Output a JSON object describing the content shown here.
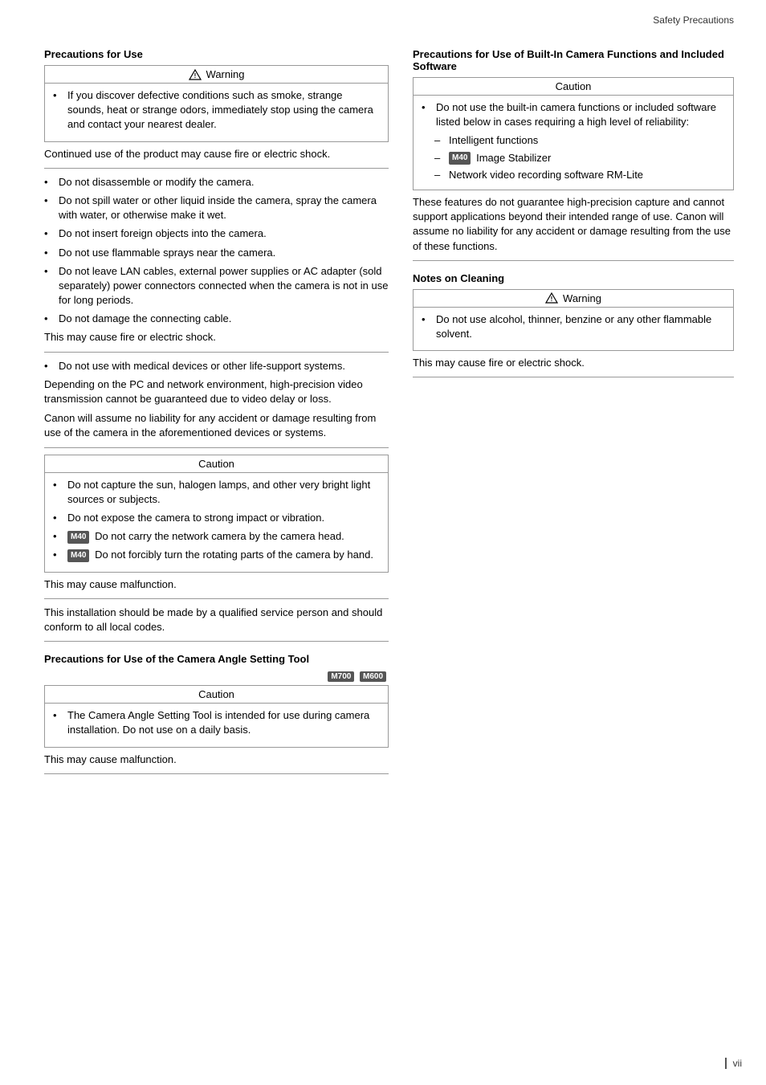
{
  "header": {
    "title": "Safety Precautions"
  },
  "page_number": "vii",
  "left": {
    "precautions_for_use": {
      "title": "Precautions for Use",
      "warning_box": {
        "label": "Warning",
        "items": [
          "If you discover defective conditions such as smoke, strange sounds, heat or strange odors, immediately stop using the camera and contact your nearest dealer."
        ]
      },
      "note1": "Continued use of the product may cause fire or electric shock.",
      "bullets": [
        "Do not disassemble or modify the camera.",
        "Do not spill water or other liquid inside the camera, spray the camera with water, or otherwise make it wet.",
        "Do not insert foreign objects into the camera.",
        "Do not use flammable sprays near the camera.",
        "Do not leave LAN cables, external power supplies or AC adapter (sold separately) power connectors connected when the camera is not in use for long periods.",
        "Do not damage the connecting cable."
      ],
      "note2": "This may cause fire or electric shock.",
      "bullets2": [
        "Do not use with medical devices or other life-support systems."
      ],
      "note3": "Depending on the PC and network environment, high-precision video transmission cannot be guaranteed due to video delay or loss.",
      "note4": "Canon will assume no liability for any accident or damage resulting from use of the camera in the aforementioned devices or systems.",
      "caution_box": {
        "label": "Caution",
        "items": [
          "Do not capture the sun, halogen lamps, and other very bright light sources or subjects.",
          "Do not expose the camera to strong impact or vibration."
        ],
        "badge_items": [
          {
            "badge": "M40",
            "text": "Do not carry the network camera by the camera head."
          },
          {
            "badge": "M40",
            "text": "Do not forcibly turn the rotating parts of the camera by hand."
          }
        ]
      },
      "note5": "This may cause malfunction.",
      "note6": "This installation should be made by a qualified service person and should conform to all local codes."
    },
    "camera_angle": {
      "title": "Precautions for Use of the Camera Angle Setting Tool",
      "badges": [
        "M700",
        "M600"
      ],
      "caution_box": {
        "label": "Caution",
        "items": [
          "The Camera Angle Setting Tool is intended for use during camera installation. Do not use on a daily basis."
        ]
      },
      "note": "This may cause malfunction."
    }
  },
  "right": {
    "builtin_functions": {
      "title": "Precautions for Use of Built-In Camera Functions and Included Software",
      "caution_box": {
        "label": "Caution",
        "items": [
          "Do not use the built-in camera functions or included software listed below in cases requiring a high level of reliability:"
        ],
        "sub_items": [
          "Intelligent functions",
          {
            "badge": "M40",
            "text": "Image Stabilizer"
          },
          "Network video recording software RM-Lite"
        ]
      },
      "note": "These features do not guarantee high-precision capture and cannot support applications beyond their intended range of use. Canon will assume no liability for any accident or damage resulting from the use of these functions."
    },
    "notes_on_cleaning": {
      "title": "Notes on Cleaning",
      "warning_box": {
        "label": "Warning",
        "items": [
          "Do not use alcohol, thinner, benzine or any other flammable solvent."
        ]
      },
      "note": "This may cause fire or electric shock."
    }
  }
}
